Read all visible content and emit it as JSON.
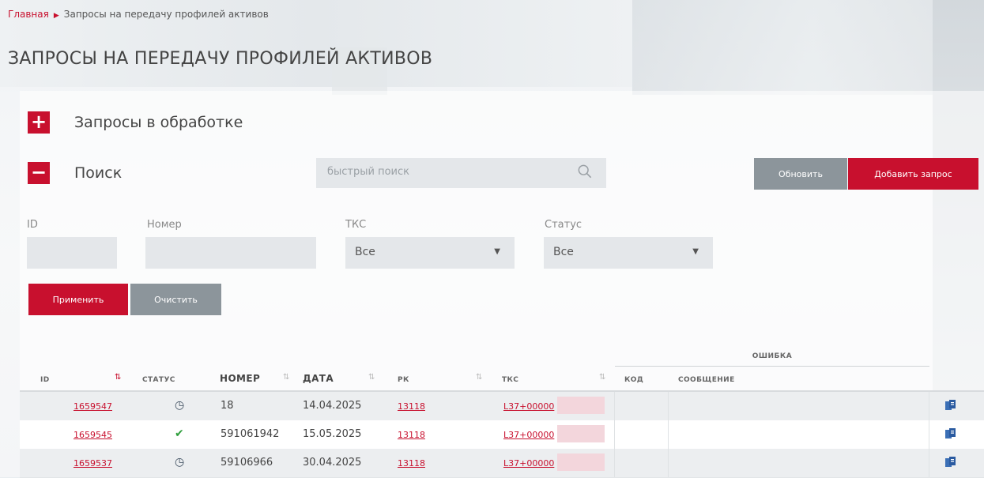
{
  "breadcrumb": {
    "home": "Главная",
    "current": "Запросы на передачу профилей активов"
  },
  "page_title": "ЗАПРОСЫ НА ПЕРЕДАЧУ ПРОФИЛЕЙ АКТИВОВ",
  "sections": {
    "in_progress": {
      "toggle": "+",
      "label": "Запросы в обработке"
    },
    "search": {
      "toggle": "−",
      "label": "Поиск"
    }
  },
  "quick_search": {
    "placeholder": "быстрый поиск"
  },
  "actions": {
    "refresh": "Обновить",
    "add_request": "Добавить запрос"
  },
  "filters": {
    "id": {
      "label": "ID",
      "value": ""
    },
    "number": {
      "label": "Номер",
      "value": ""
    },
    "tks": {
      "label": "ТКС",
      "value": "Все"
    },
    "status": {
      "label": "Статус",
      "value": "Все"
    },
    "apply": "Применить",
    "clear": "Очистить"
  },
  "table": {
    "error_group": "ОШИБКА",
    "columns": {
      "id": "ID",
      "status": "СТАТУС",
      "number": "НОМЕР",
      "date": "ДАТА",
      "rk": "РК",
      "tks": "ТКС",
      "code": "КОД",
      "message": "СООБЩЕНИЕ"
    },
    "rows": [
      {
        "id": "1659547",
        "status": "pending",
        "number": "18",
        "date": "14.04.2025",
        "rk": "13118",
        "tks": "L37+00000",
        "code": "",
        "message": ""
      },
      {
        "id": "1659545",
        "status": "done",
        "number": "591061942",
        "date": "15.05.2025",
        "rk": "13118",
        "tks": "L37+00000",
        "code": "",
        "message": ""
      },
      {
        "id": "1659537",
        "status": "pending",
        "number": "59106966",
        "date": "30.04.2025",
        "rk": "13118",
        "tks": "L37+00000",
        "code": "",
        "message": ""
      }
    ]
  },
  "icons": {
    "status_pending": "clock-icon",
    "status_done": "checkmark-icon",
    "row_action": "documents-icon",
    "search": "search-icon"
  },
  "colors": {
    "accent": "#c8102e",
    "button_gray": "#8c959b",
    "status_done": "#2e9e3c",
    "status_pending": "#3a4a5c"
  }
}
